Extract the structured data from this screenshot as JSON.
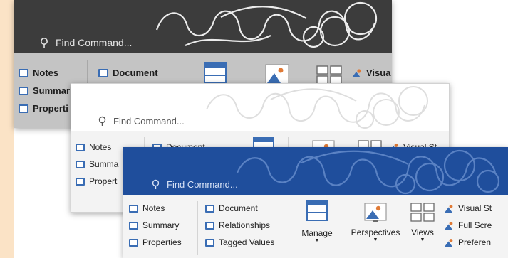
{
  "search": {
    "placeholder": "Find Command..."
  },
  "panels": [
    {
      "theme": "dark",
      "colors": {
        "header": "#3c3c3c",
        "ribbon": "#c4c4c4",
        "accent": "#3a6db4"
      },
      "col1": [
        "Notes",
        "Summar",
        "Properti"
      ],
      "col2": [
        "Document"
      ],
      "visual": "Visua"
    },
    {
      "theme": "light",
      "colors": {
        "header": "#ffffff",
        "ribbon": "#f3f3f3",
        "accent": "#3a6db4"
      },
      "col1": [
        "Notes",
        "Summa",
        "Propert"
      ],
      "col2": [
        "Document"
      ],
      "visual": "Visual St"
    },
    {
      "theme": "blue",
      "colors": {
        "header": "#1f4e9c",
        "ribbon": "#f4f4f4",
        "accent": "#3a6db4"
      },
      "col1": [
        "Notes",
        "Summary",
        "Properties"
      ],
      "col2": [
        "Document",
        "Relationships",
        "Tagged Values"
      ],
      "manage": "Manage",
      "perspectives": "Perspectives",
      "views": "Views",
      "col3": [
        "Visual St",
        "Full Scre",
        "Preferen"
      ]
    }
  ],
  "icons": [
    "search-icon",
    "checkbox-icon",
    "manage-icon",
    "perspectives-icon",
    "views-icon",
    "visual-style-icon",
    "full-screen-icon",
    "preferences-icon"
  ]
}
